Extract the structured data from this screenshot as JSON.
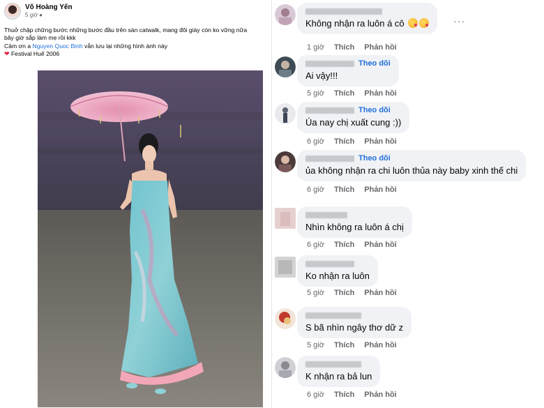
{
  "post": {
    "author": "Võ Hoàng Yến",
    "time": "5 giờ",
    "caption_line1": "Thuở chập chững bước những bước đầu trên sàn catwalk, mang đôi giày còn ko vững nữa",
    "caption_line2": "bây giờ sắp làm mẹ rồi kkk",
    "caption_line3_before": "Cảm ơn a ",
    "caption_line3_link": "Nguyen Quoc Binh",
    "caption_line3_after": " vẫn lưu lại những hình ảnh này",
    "caption_line4": "Festival Huế 2006",
    "heart_icon": "heart-icon",
    "globe_icon": "globe-icon"
  },
  "comments": [
    {
      "text": "Không nhận ra luôn á cô",
      "time": "1 giờ",
      "like": "Thích",
      "reply": "Phản hồi",
      "follow": "",
      "emojis": 2
    },
    {
      "text": "Ai vậy!!!",
      "time": "5 giờ",
      "like": "Thích",
      "reply": "Phản hồi",
      "follow": "Theo dõi"
    },
    {
      "text": "Úa nay chị xuất cung :))",
      "time": "6 giờ",
      "like": "Thích",
      "reply": "Phản hồi",
      "follow": "Theo dõi"
    },
    {
      "text": "ủa không nhận ra chi luôn thủa này baby xinh thế chi",
      "time": "6 giờ",
      "like": "Thích",
      "reply": "Phản hồi",
      "follow": "Theo dõi"
    },
    {
      "text": "Nhìn không ra luôn á chị",
      "time": "6 giờ",
      "like": "Thích",
      "reply": "Phản hồi",
      "follow": ""
    },
    {
      "text": "Ko nhận ra luôn",
      "time": "5 giờ",
      "like": "Thích",
      "reply": "Phản hồi",
      "follow": ""
    },
    {
      "text": "S bã nhìn ngây thơ dữ z",
      "time": "5 giờ",
      "like": "Thích",
      "reply": "Phản hồi",
      "follow": ""
    },
    {
      "text": "K nhận ra bả lun",
      "time": "6 giờ",
      "like": "Thích",
      "reply": "Phản hồi",
      "follow": ""
    }
  ],
  "icons": {
    "more": "more-options-icon"
  },
  "colors": {
    "link": "#216fdb",
    "muted": "#65676b",
    "bubble": "#f0f2f5"
  }
}
